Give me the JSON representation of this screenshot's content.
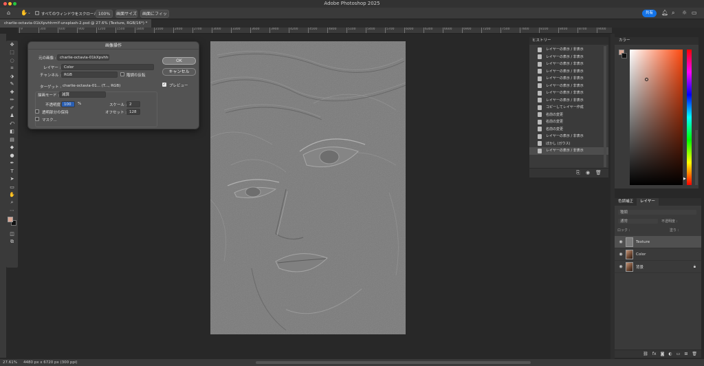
{
  "app": {
    "title": "Adobe Photoshop 2025"
  },
  "options_bar": {
    "scroll_all_label": "すべてのウィンドウをスクロール",
    "zoom_value": "100%",
    "actual_size": "画面サイズ",
    "fit_screen": "画面にフィット",
    "share": "共有"
  },
  "document_tab": {
    "label": "charlie-octavia-01kXpvhhrmY-unsplash-2.psd @ 27.6% (Texture, RGB/16*) *"
  },
  "ruler_ticks": [
    "9",
    "300",
    "600",
    "900",
    "1200",
    "1500",
    "1800",
    "2100",
    "2400",
    "2700",
    "3000",
    "3300",
    "3600",
    "3900",
    "4200",
    "4500",
    "4800",
    "5100",
    "5400",
    "5700",
    "6000",
    "6300",
    "6600",
    "6900",
    "7200",
    "7500",
    "7800",
    "8100",
    "8400",
    "8700",
    "9000",
    "9300",
    "9600"
  ],
  "dialog": {
    "title": "画像操作",
    "source_label": "元の画像 :",
    "source_value": "charlie-octavia-01kXpvhhr...",
    "layer_label": "レイヤー :",
    "layer_value": "Color",
    "channel_label": "チャンネル :",
    "channel_value": "RGB",
    "invert_label": "階調の反転",
    "target_label": "ターゲット :",
    "target_value": "charlie-octavia-01... (T..., RGB)",
    "blend_label": "描画モード :",
    "blend_value": "減算",
    "opacity_label": "不透明度 :",
    "opacity_value": "100",
    "opacity_unit": "%",
    "scale_label": "スケール :",
    "scale_value": "2",
    "offset_label": "オフセット :",
    "offset_value": "128",
    "preserve_label": "透明部分の保持",
    "mask_label": "マスク...",
    "ok": "OK",
    "cancel": "キャンセル",
    "preview": "プレビュー"
  },
  "history": {
    "tab": "ヒストリー",
    "items": [
      "レイヤーの表示 / 非表示",
      "レイヤーの表示 / 非表示",
      "レイヤーの表示 / 非表示",
      "レイヤーの表示 / 非表示",
      "レイヤーの表示 / 非表示",
      "レイヤーの表示 / 非表示",
      "レイヤーの表示 / 非表示",
      "レイヤーの表示 / 非表示",
      "コピーしてレイヤー作成",
      "名前の変更",
      "名前の変更",
      "名前の変更",
      "レイヤーの表示 / 非表示",
      "ぼかし (ガウス)",
      "レイヤーの表示 / 非表示"
    ]
  },
  "color_panel": {
    "tab": "カラー",
    "foreground": "#d9a592",
    "hue_color": "#ff4a10"
  },
  "layers_panel": {
    "tab_adjust": "色調補正",
    "tab_layers": "レイヤー",
    "search_placeholder": "種類",
    "blend_mode": "通常",
    "opacity_label": "不透明度 :",
    "lock_label": "ロック :",
    "fill_label": "塗り :",
    "layers": [
      {
        "name": "Texture",
        "visible": true,
        "selected": true
      },
      {
        "name": "Color",
        "visible": true,
        "selected": false
      },
      {
        "name": "背景",
        "visible": true,
        "selected": false
      }
    ]
  },
  "status": {
    "zoom": "27.61%",
    "doc_info": "4480 px x 6720 px (300 ppi)"
  }
}
